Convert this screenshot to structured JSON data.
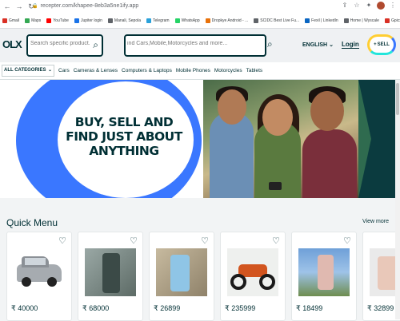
{
  "browser": {
    "url": "recepter.com/khapee-8eb3a5ne1ify.app",
    "bookmarks": [
      {
        "label": "Gmail",
        "color": "#d93025"
      },
      {
        "label": "Maps",
        "color": "#34a853"
      },
      {
        "label": "YouTube",
        "color": "#ff0000"
      },
      {
        "label": "Jupiter login",
        "color": "#1a73e8"
      },
      {
        "label": "Manali, Sepola",
        "color": "#5f6368"
      },
      {
        "label": "Telegram",
        "color": "#2aa1da"
      },
      {
        "label": "WhatsApp",
        "color": "#25d366"
      },
      {
        "label": "Dropkye Android - ...",
        "color": "#e8710a"
      },
      {
        "label": "SCIDC Best Live Fu...",
        "color": "#5f6368"
      },
      {
        "label": "Fexil | LinkedIn",
        "color": "#0a66c2"
      },
      {
        "label": "Home | Wyscale",
        "color": "#5f6368"
      },
      {
        "label": "Gpicx",
        "color": "#d93025"
      }
    ]
  },
  "header": {
    "logo": "OLX",
    "location_placeholder": "Search specific product...",
    "search_placeholder": "ind Cars,Mobile,Motorcycles and more...",
    "language": "ENGLISH",
    "login": "Login",
    "sell": "SELL"
  },
  "categories": {
    "all_label": "ALL CATEGORIES",
    "items": [
      "Cars",
      "Cameras & Lenses",
      "Computers & Laptops",
      "Mobile Phones",
      "Motorcycles",
      "Tablets"
    ]
  },
  "banner": {
    "headline": "BUY, SELL AND FIND JUST ABOUT ANYTHING"
  },
  "quick_menu": {
    "title": "Quick Menu",
    "view_more": "View more",
    "cards": [
      {
        "price": "₹ 40000",
        "image": "car"
      },
      {
        "price": "₹ 68000",
        "image": "phone"
      },
      {
        "price": "₹ 26899",
        "image": "phone"
      },
      {
        "price": "₹ 235999",
        "image": "motorcycle"
      },
      {
        "price": "₹ 18499",
        "image": "phone"
      },
      {
        "price": "₹ 32899",
        "image": "phone"
      }
    ]
  },
  "colors": {
    "brand_dark": "#002f34",
    "banner_blue": "#3a77ff",
    "sell_yellow": "#ffce32",
    "sell_teal": "#23e5db"
  }
}
